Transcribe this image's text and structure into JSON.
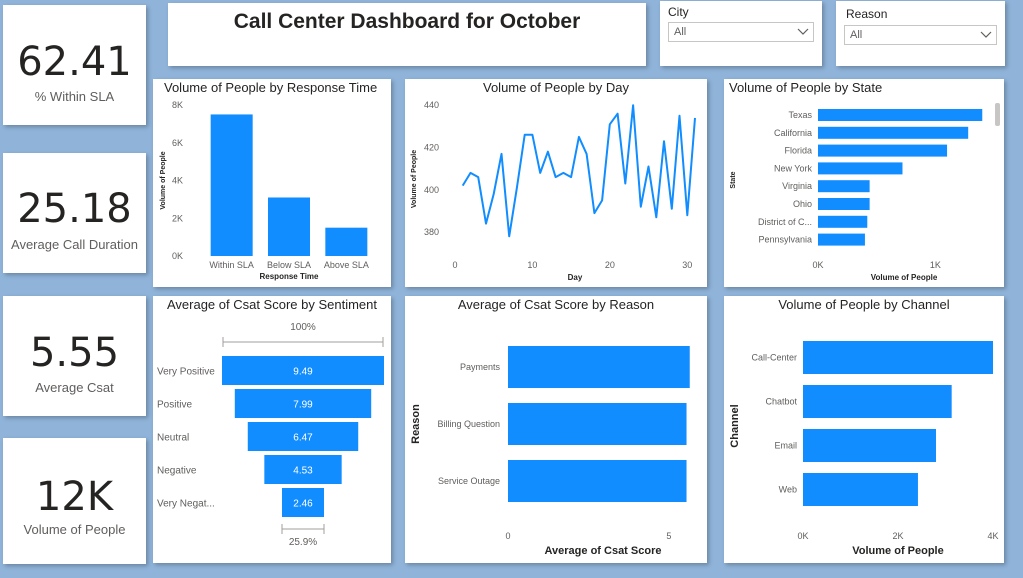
{
  "header": {
    "title": "Call Center Dashboard for October"
  },
  "slicers": {
    "city": {
      "label": "City",
      "value": "All"
    },
    "reason": {
      "label": "Reason",
      "value": "All"
    }
  },
  "kpis": [
    {
      "value": "62.41",
      "label": "% Within SLA"
    },
    {
      "value": "25.18",
      "label": "Average Call Duration"
    },
    {
      "value": "5.55",
      "label": "Average Csat"
    },
    {
      "value": "12K",
      "label": "Volume of People"
    }
  ],
  "colors": {
    "bar": "#118DFF",
    "background": "#8fb3d9"
  },
  "chart_data": [
    {
      "id": "response_time",
      "type": "bar",
      "title": "Volume of People by Response Time",
      "xlabel": "Response Time",
      "ylabel": "Volume of People",
      "categories": [
        "Within SLA",
        "Below SLA",
        "Above SLA"
      ],
      "values": [
        7500,
        3100,
        1500
      ],
      "ylim": [
        0,
        8000
      ],
      "yticks": [
        0,
        2000,
        4000,
        6000,
        8000
      ],
      "ytick_labels": [
        "0K",
        "2K",
        "4K",
        "6K",
        "8K"
      ],
      "grid": false
    },
    {
      "id": "by_day",
      "type": "line",
      "title": "Volume of People by Day",
      "xlabel": "Day",
      "ylabel": "Volume of People",
      "x": [
        1,
        2,
        3,
        4,
        5,
        6,
        7,
        8,
        9,
        10,
        11,
        12,
        13,
        14,
        15,
        16,
        17,
        18,
        19,
        20,
        21,
        22,
        23,
        24,
        25,
        26,
        27,
        28,
        29,
        30,
        31
      ],
      "values": [
        402,
        408,
        406,
        384,
        398,
        417,
        378,
        401,
        426,
        426,
        408,
        418,
        406,
        408,
        406,
        425,
        417,
        389,
        395,
        431,
        436,
        403,
        440,
        392,
        411,
        387,
        423,
        391,
        435,
        388,
        434
      ],
      "xlim": [
        0,
        31
      ],
      "ylim": [
        372,
        442
      ],
      "xticks": [
        0,
        10,
        20,
        30
      ],
      "yticks": [
        380,
        400,
        420,
        440
      ],
      "grid": false
    },
    {
      "id": "by_state",
      "type": "bar",
      "orientation": "horizontal",
      "title": "Volume of People by State",
      "xlabel": "Volume of People",
      "ylabel": "State",
      "categories": [
        "Texas",
        "California",
        "Florida",
        "New York",
        "Virginia",
        "Ohio",
        "District of C...",
        "Pennsylvania"
      ],
      "values": [
        1400,
        1280,
        1100,
        720,
        440,
        440,
        420,
        400
      ],
      "xlim": [
        0,
        1500
      ],
      "xticks": [
        0,
        1000
      ],
      "xtick_labels": [
        "0K",
        "1K"
      ],
      "grid": false
    },
    {
      "id": "csat_sentiment",
      "type": "funnel",
      "title": "Average of Csat Score by Sentiment",
      "categories": [
        "Very Positive",
        "Positive",
        "Neutral",
        "Negative",
        "Very Negat..."
      ],
      "values": [
        9.49,
        7.99,
        6.47,
        4.53,
        2.46
      ],
      "value_labels": [
        "9.49",
        "7.99",
        "6.47",
        "4.53",
        "2.46"
      ],
      "top_percent": "100%",
      "bottom_percent": "25.9%"
    },
    {
      "id": "csat_reason",
      "type": "bar",
      "orientation": "horizontal",
      "title": "Average of Csat Score by Reason",
      "xlabel": "Average of Csat Score",
      "ylabel": "Reason",
      "categories": [
        "Payments",
        "Billing Question",
        "Service Outage"
      ],
      "values": [
        5.65,
        5.55,
        5.55
      ],
      "xlim": [
        0,
        6
      ],
      "xticks": [
        0,
        5
      ],
      "grid": false
    },
    {
      "id": "by_channel",
      "type": "bar",
      "orientation": "horizontal",
      "title": "Volume of People by Channel",
      "xlabel": "Volume of People",
      "ylabel": "Channel",
      "categories": [
        "Call-Center",
        "Chatbot",
        "Email",
        "Web"
      ],
      "values": [
        4000,
        3130,
        2800,
        2420
      ],
      "xlim": [
        0,
        4000
      ],
      "xticks": [
        0,
        2000,
        4000
      ],
      "xtick_labels": [
        "0K",
        "2K",
        "4K"
      ],
      "grid": false
    }
  ]
}
